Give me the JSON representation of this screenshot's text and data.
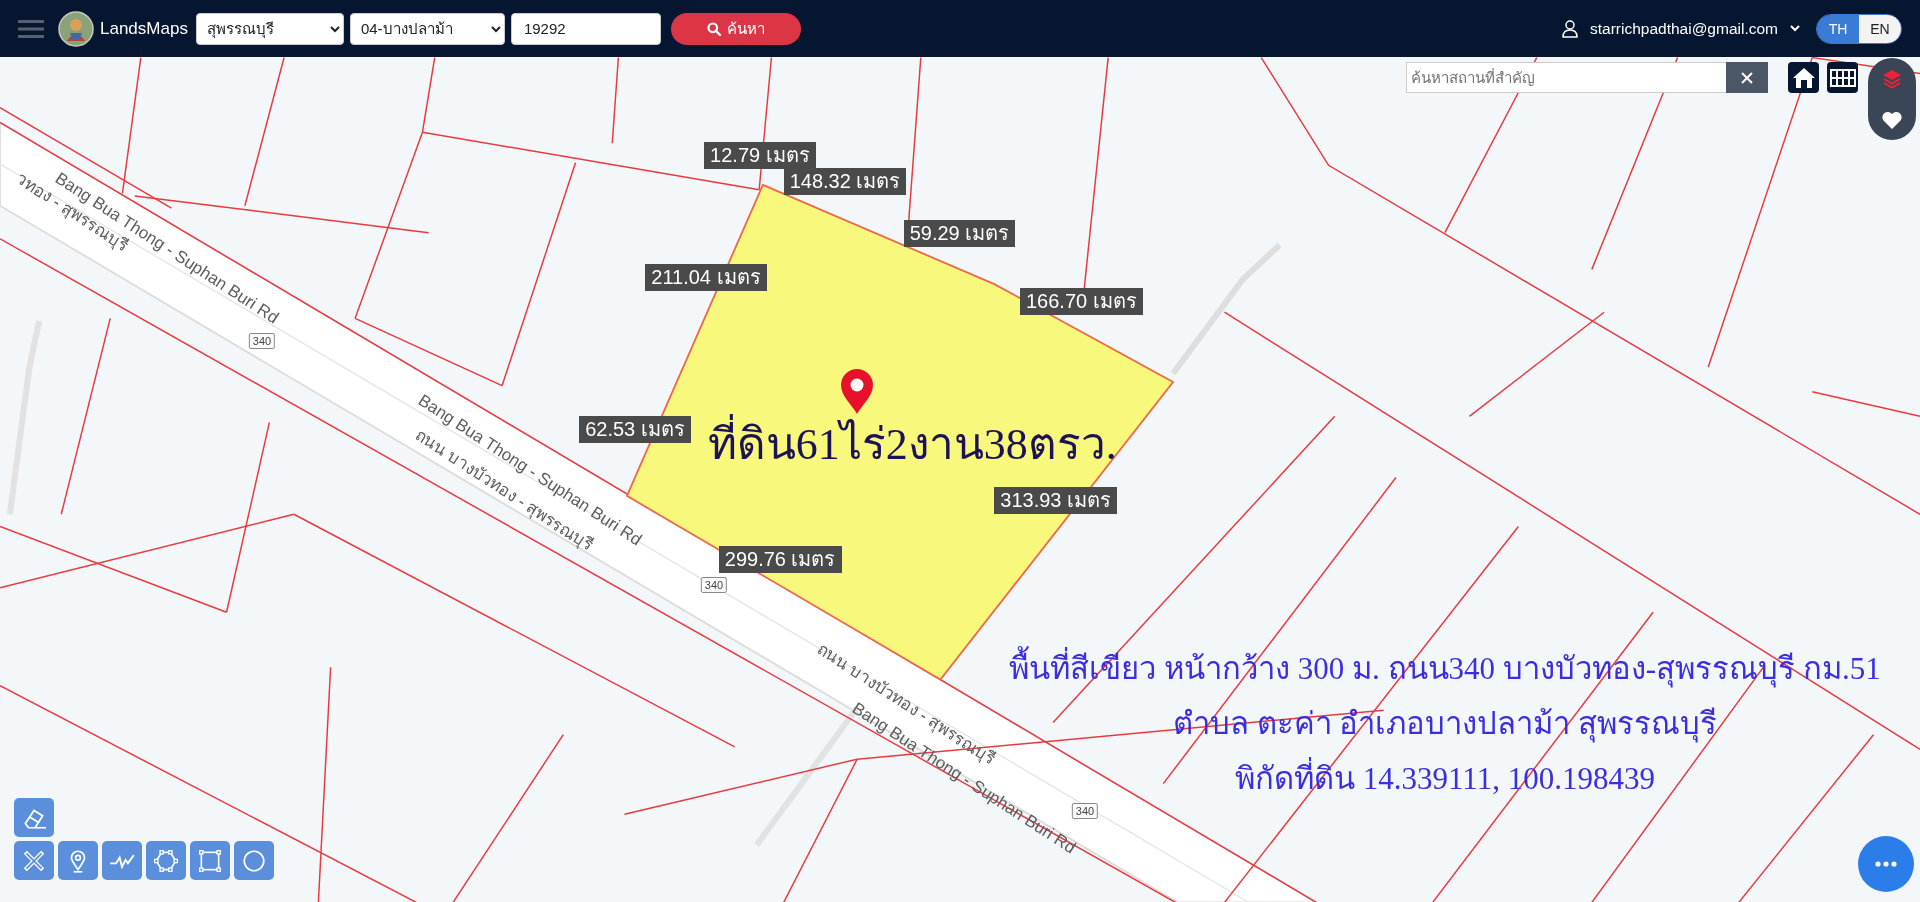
{
  "header": {
    "app_name": "LandsMaps",
    "province_select": "สุพรรณบุรี",
    "district_select": "04-บางปลาม้า",
    "parcel_number": "19292",
    "search_button": "ค้นหา",
    "user_email": "starrichpadthai@gmail.com",
    "languages": [
      {
        "label": "TH",
        "selected": true
      },
      {
        "label": "EN",
        "selected": false
      }
    ]
  },
  "map": {
    "place_search": {
      "placeholder": "ค้นหาสถานที่สำคัญ"
    },
    "road_labels": [
      {
        "text": "Bang Bua Thong - Suphan Buri Rd"
      },
      {
        "text": "วทอง - สุพรรณบุรี"
      },
      {
        "text": "Bang Bua Thong - Suphan Buri Rd"
      },
      {
        "text": "ถนน บางบัวทอง - สุพรรณบุรี"
      },
      {
        "text": "ถนน บางบัวทอง - สุพรรณบุรี"
      },
      {
        "text": "Bang Bua Thong - Suphan Buri Rd"
      }
    ],
    "road_shields": [
      "340",
      "340",
      "340"
    ],
    "measurements": [
      "12.79 เมตร",
      "148.32 เมตร",
      "59.29 เมตร",
      "211.04 เมตร",
      "166.70 เมตร",
      "62.53 เมตร",
      "313.93 เมตร",
      "299.76 เมตร"
    ],
    "area_label": "ที่ดิน61ไร่2งาน38ตรว.",
    "caption_lines": [
      "พื้นที่สีเขียว หน้ากว้าง 300 ม. ถนน340 บางบัวทอง-สุพรรณบุรี กม.51",
      "ตำบล ตะค่า อำเภอบางปลาม้า สุพรรณบุรี",
      "พิกัดที่ดิน 14.339111, 100.198439"
    ]
  }
}
